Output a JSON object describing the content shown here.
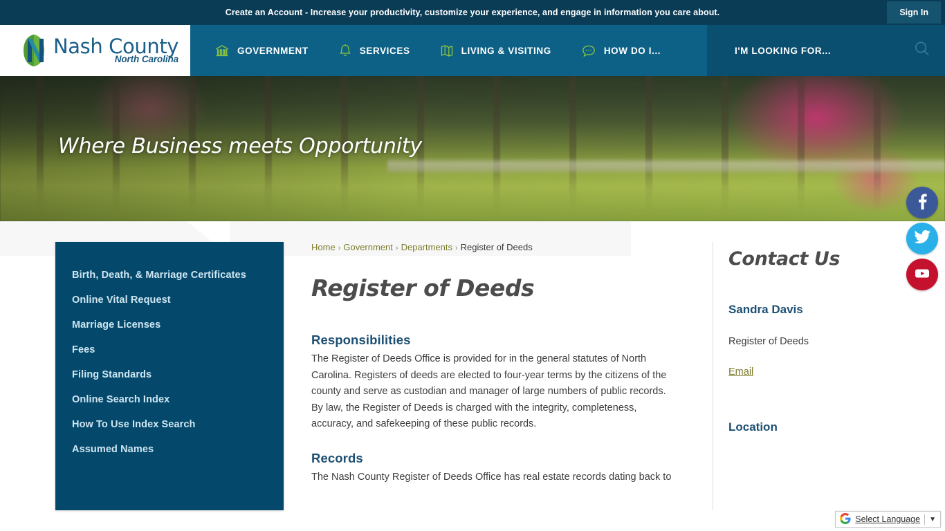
{
  "topbar": {
    "message": "Create an Account - Increase your productivity, customize your experience, and engage in information you care about.",
    "signin_label": "Sign In"
  },
  "logo": {
    "title": "Nash County",
    "subtitle": "North Carolina",
    "mark_icon": "nash-n-monogram-icon",
    "colors": {
      "green": "#6cb33f",
      "blue": "#1c6ba0",
      "text": "#1a5f8a"
    }
  },
  "nav": {
    "items": [
      {
        "label": "GOVERNMENT",
        "icon": "bank-building-icon"
      },
      {
        "label": "SERVICES",
        "icon": "bell-icon"
      },
      {
        "label": "LIVING & VISITING",
        "icon": "map-icon"
      },
      {
        "label": "HOW DO I...",
        "icon": "speech-bubble-icon"
      }
    ],
    "looking_for_label": "I'M LOOKING FOR...",
    "search_icon": "search-icon",
    "icon_color": "#8dc63f"
  },
  "hero": {
    "tagline": "Where Business meets Opportunity"
  },
  "sidebar": {
    "items": [
      {
        "label": "Birth, Death, & Marriage Certificates"
      },
      {
        "label": "Online Vital Request"
      },
      {
        "label": "Marriage Licenses"
      },
      {
        "label": "Fees"
      },
      {
        "label": "Filing Standards"
      },
      {
        "label": "Online Search Index"
      },
      {
        "label": "How To Use Index Search"
      },
      {
        "label": "Assumed Names"
      }
    ],
    "background": "#04496b"
  },
  "breadcrumb": {
    "items": [
      {
        "label": "Home",
        "link": true
      },
      {
        "label": "Government",
        "link": true
      },
      {
        "label": "Departments",
        "link": true
      },
      {
        "label": "Register of Deeds",
        "link": false
      }
    ],
    "separator": "›"
  },
  "main": {
    "title": "Register of Deeds",
    "sections": [
      {
        "heading": "Responsibilities",
        "body": "The Register of Deeds Office is provided for in the general statutes of North Carolina. Registers of deeds are elected to four-year terms by the citizens of the county and serve as custodian and manager of large numbers of public records. By law, the Register of Deeds is charged with the integrity, completeness, accuracy, and safekeeping of these public records."
      },
      {
        "heading": "Records",
        "body": "The Nash County Register of Deeds Office has real estate records dating back to"
      }
    ]
  },
  "contact": {
    "title": "Contact Us",
    "name": "Sandra Davis",
    "role": "Register of Deeds",
    "email_label": "Email",
    "location_label": "Location"
  },
  "social": [
    {
      "name": "facebook",
      "icon": "facebook-icon",
      "color": "#3b5998",
      "glyph": "f"
    },
    {
      "name": "twitter",
      "icon": "twitter-icon",
      "color": "#29b0e8",
      "glyph": "t"
    },
    {
      "name": "youtube",
      "icon": "youtube-icon",
      "color": "#c4122e",
      "glyph": "y"
    }
  ],
  "translate": {
    "label": "Select Language",
    "caret": "▼",
    "logo_icon": "google-g-icon"
  }
}
